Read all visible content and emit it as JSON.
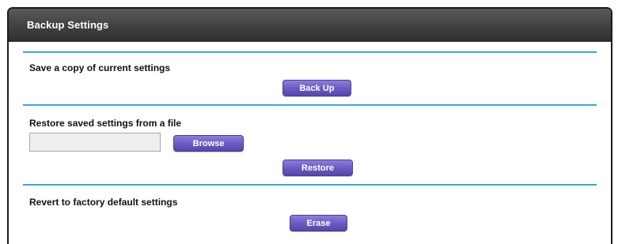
{
  "panel": {
    "title": "Backup Settings"
  },
  "sections": {
    "backup": {
      "label": "Save a copy of current settings",
      "button": "Back Up"
    },
    "restore": {
      "label": "Restore saved settings from a file",
      "file_value": "",
      "browse_button": "Browse",
      "restore_button": "Restore"
    },
    "erase": {
      "label": "Revert to factory default settings",
      "button": "Erase"
    }
  },
  "colors": {
    "title_bar": "#3c3c3c",
    "divider": "#3aa7d8",
    "button": "#6b5cc6"
  }
}
